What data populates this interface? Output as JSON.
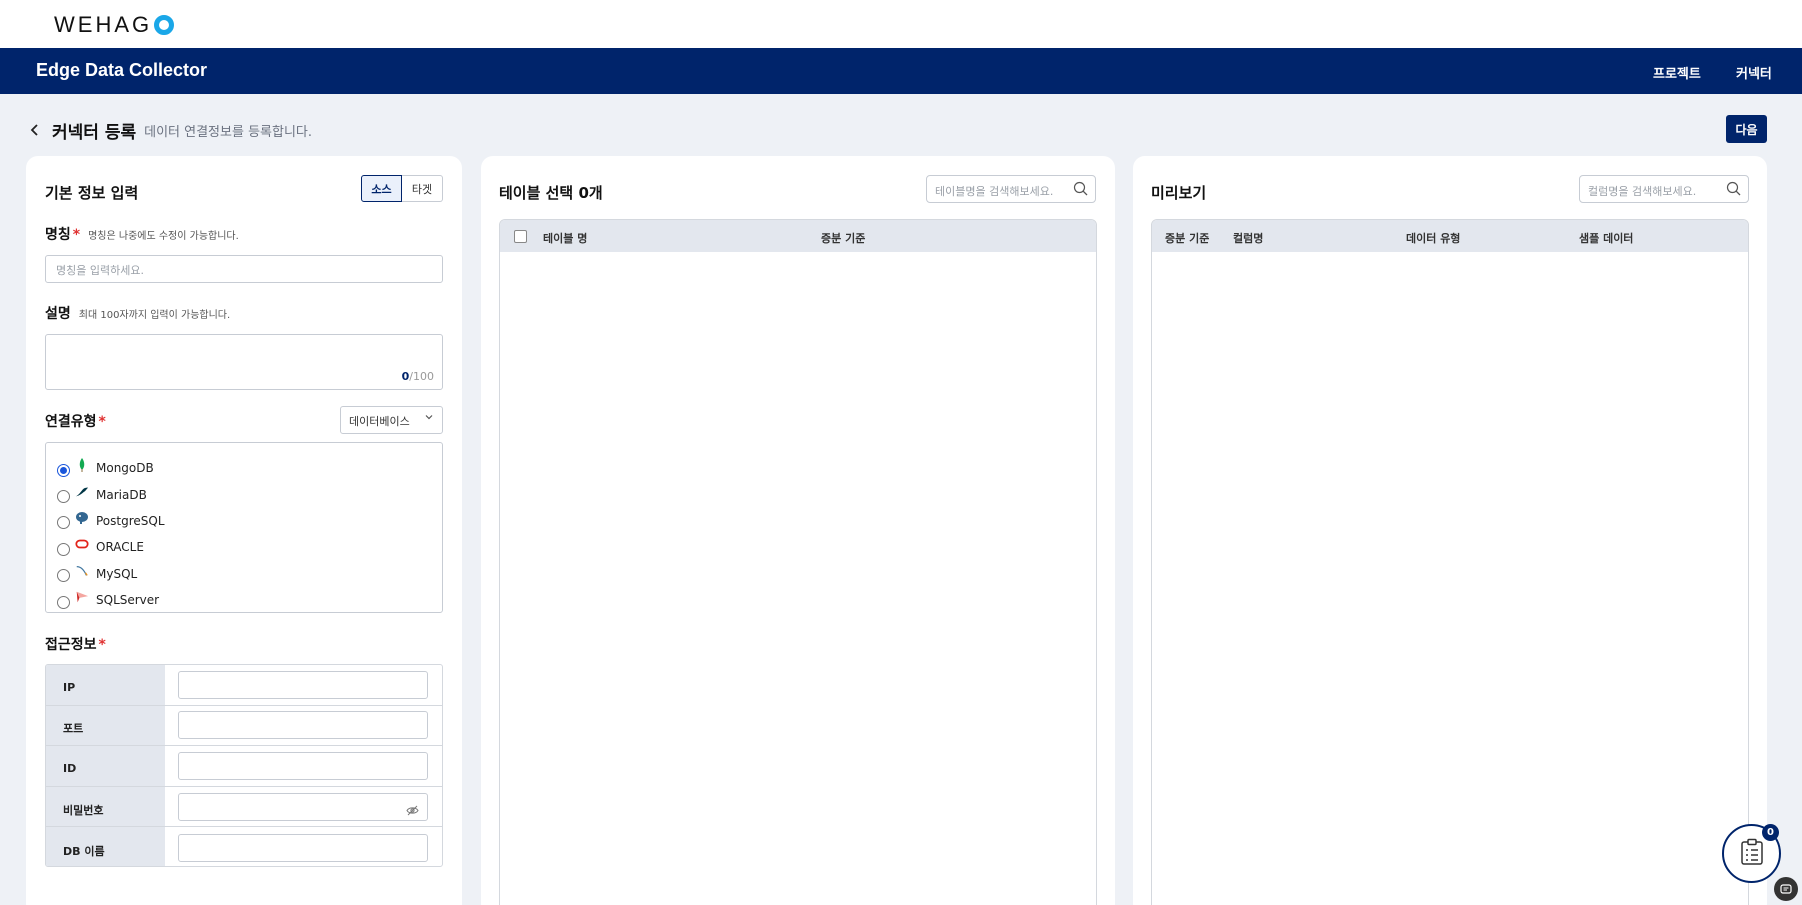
{
  "brand": {
    "logo_text": "WEHAG"
  },
  "navbar": {
    "app_title": "Edge Data Collector",
    "items": [
      {
        "label": "프로젝트"
      },
      {
        "label": "커넥터"
      }
    ]
  },
  "page": {
    "title": "커넥터 등록",
    "subtitle": "데이터 연결정보를 등록합니다.",
    "next_label": "다음"
  },
  "basic_info": {
    "title": "기본 정보 입력",
    "segment": {
      "source": "소스",
      "target": "타겟",
      "selected": "source"
    },
    "name": {
      "label": "명칭",
      "hint": "명칭은 나중에도 수정이 가능합니다.",
      "placeholder": "명칭을 입력하세요.",
      "value": ""
    },
    "description": {
      "label": "설명",
      "hint": "최대 100자까지 입력이 가능합니다.",
      "count": "0",
      "max": "/100"
    },
    "connection_type": {
      "label": "연결유형",
      "select_value": "데이터베이스",
      "options": [
        {
          "label": "MongoDB",
          "icon": "mongodb-icon",
          "checked": true
        },
        {
          "label": "MariaDB",
          "icon": "mariadb-icon",
          "checked": false
        },
        {
          "label": "PostgreSQL",
          "icon": "postgresql-icon",
          "checked": false
        },
        {
          "label": "ORACLE",
          "icon": "oracle-icon",
          "checked": false
        },
        {
          "label": "MySQL",
          "icon": "mysql-icon",
          "checked": false
        },
        {
          "label": "SQLServer",
          "icon": "sqlserver-icon",
          "checked": false
        }
      ]
    },
    "access": {
      "label": "접근정보",
      "fields": [
        {
          "key": "IP",
          "value": ""
        },
        {
          "key": "포트",
          "value": ""
        },
        {
          "key": "ID",
          "value": ""
        },
        {
          "key": "비밀번호",
          "value": ""
        },
        {
          "key": "DB 이름",
          "value": ""
        }
      ]
    }
  },
  "table_select": {
    "title": "테이블 선택 0개",
    "search_placeholder": "테이블명을 검색해보세요.",
    "columns": [
      "테이블 명",
      "증분 기준"
    ]
  },
  "preview": {
    "title": "미리보기",
    "search_placeholder": "컬럼명을 검색해보세요.",
    "columns": [
      "증분 기준",
      "컬럼명",
      "데이터 유형",
      "샘플 데이터"
    ]
  },
  "floating": {
    "badge_count": "0"
  },
  "colors": {
    "primary": "#00246b",
    "accent_logo": "#1aa7e8",
    "required": "#e03131",
    "background": "#eef1f6"
  }
}
